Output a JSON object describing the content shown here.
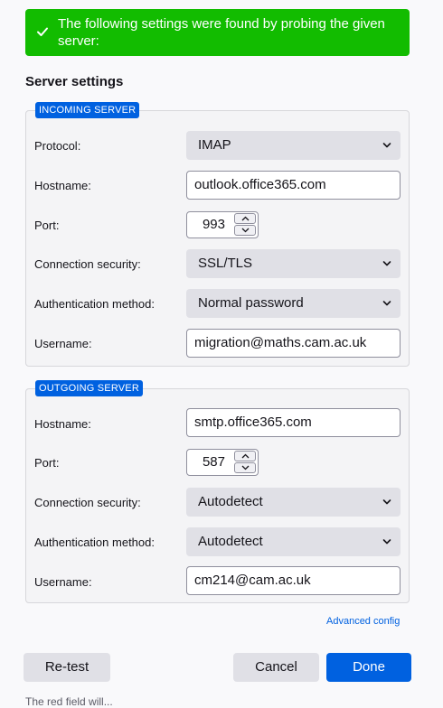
{
  "banner": {
    "message": "The following settings were found by probing the given server:",
    "icon": "check-icon",
    "color": "#12bc00"
  },
  "section_title": "Server settings",
  "incoming": {
    "legend": "INCOMING SERVER",
    "protocol_label": "Protocol:",
    "protocol_value": "IMAP",
    "hostname_label": "Hostname:",
    "hostname_value": "outlook.office365.com",
    "port_label": "Port:",
    "port_value": "993",
    "security_label": "Connection security:",
    "security_value": "SSL/TLS",
    "auth_label": "Authentication method:",
    "auth_value": "Normal password",
    "username_label": "Username:",
    "username_value": "migration@maths.cam.ac.uk"
  },
  "outgoing": {
    "legend": "OUTGOING SERVER",
    "hostname_label": "Hostname:",
    "hostname_value": "smtp.office365.com",
    "port_label": "Port:",
    "port_value": "587",
    "security_label": "Connection security:",
    "security_value": "Autodetect",
    "auth_label": "Authentication method:",
    "auth_value": "Autodetect",
    "username_label": "Username:",
    "username_value": "cm214@cam.ac.uk"
  },
  "advanced_config_label": "Advanced config",
  "buttons": {
    "retest": "Re-test",
    "cancel": "Cancel",
    "done": "Done"
  },
  "footnote": "The red field will... ",
  "colors": {
    "accent": "#0061e0",
    "success": "#12bc00"
  }
}
